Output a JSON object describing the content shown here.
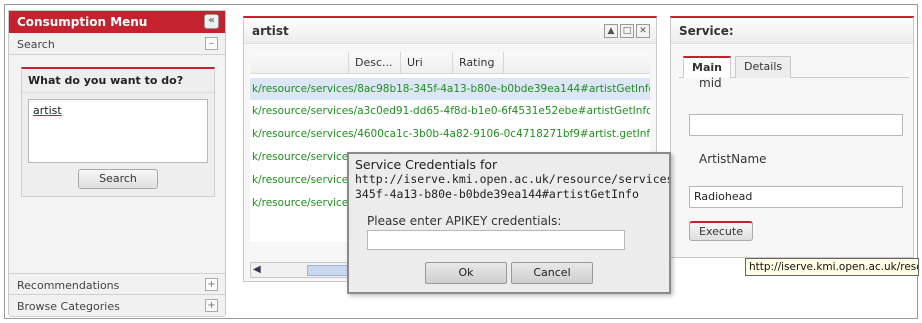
{
  "consumption_menu": {
    "title": "Consumption Menu",
    "collapse_icon": "«",
    "search_section": "Search",
    "search_toggle": "–",
    "prompt": "What do you want to do?",
    "query": "artist",
    "search_button": "Search",
    "recommendations": "Recommendations",
    "recommendations_toggle": "+",
    "browse_categories": "Browse Categories",
    "browse_toggle": "+"
  },
  "results_panel": {
    "title": "artist",
    "window_buttons": [
      "▲",
      "□",
      "✕"
    ],
    "columns": [
      "Desc...",
      "Uri",
      "Rating"
    ],
    "rows": [
      "k/resource/services/8ac98b18-345f-4a13-b80e-b0bde39ea144#artistGetInfo",
      "k/resource/services/a3c0ed91-dd65-4f8d-b1e0-6f4531e52ebe#artistGetInfo",
      "k/resource/services/4600ca1c-3b0b-4a82-9106-0c4718271bf9#artist.getInfo",
      "k/resource/service",
      "k/resource/service",
      "k/resource/service"
    ],
    "scroll_left_icon": "◀"
  },
  "service_panel": {
    "title": "Service:",
    "tabs": [
      "Main",
      "Details"
    ],
    "field1_label": "mid",
    "field1_value": "",
    "field2_label": "ArtistName",
    "field2_value": "Radiohead",
    "execute_button": "Execute"
  },
  "tooltip": {
    "text": "http://iserve.kmi.open.ac.uk/reso"
  },
  "dialog": {
    "title_line1": "Service Credentials for",
    "title_line2": "http://iserve.kmi.open.ac.uk/resource/services",
    "title_line3": "345f-4a13-b80e-b0bde39ea144#artistGetInfo",
    "prompt": "Please enter APIKEY credentials:",
    "input_value": "",
    "ok_button": "Ok",
    "cancel_button": "Cancel"
  },
  "colors": {
    "accent": "#c4222e",
    "link_green": "#1f8f1f",
    "selected_row": "#dce6f4"
  }
}
